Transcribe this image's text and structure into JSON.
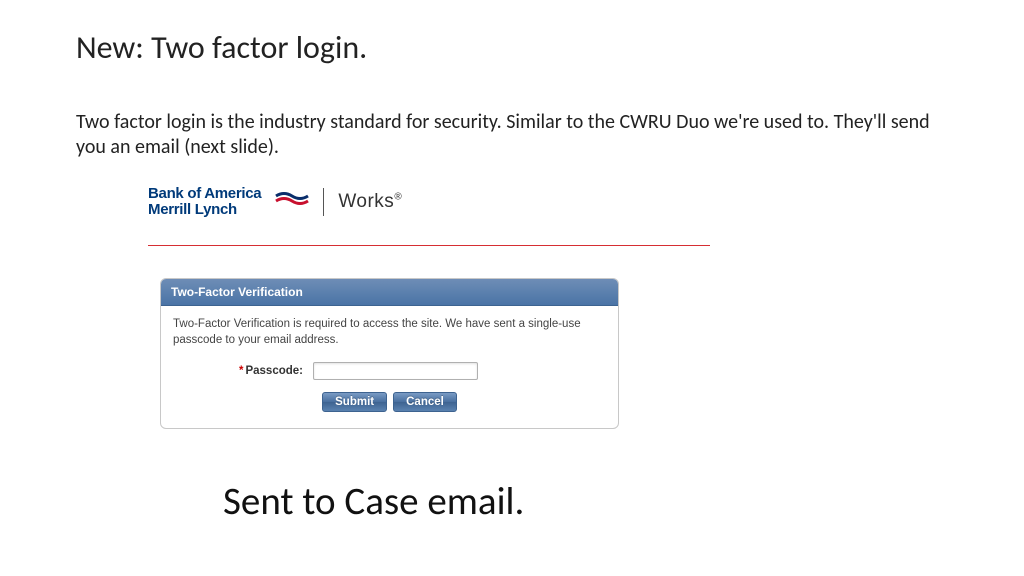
{
  "slide": {
    "title": "New: Two factor login.",
    "subtext": "Two factor login is the industry standard for security. Similar to the CWRU Duo we're used to. They'll send you an email (next slide).",
    "caption": "Sent to Case email."
  },
  "logo": {
    "boa_line1": "Bank of America",
    "boa_line2": "Merrill Lynch",
    "works": "Works",
    "registered": "®"
  },
  "panel": {
    "header": "Two-Factor Verification",
    "message": "Two-Factor Verification is required to access the site. We have sent a single-use passcode to your email address.",
    "required_mark": "*",
    "passcode_label": "Passcode:",
    "passcode_value": "",
    "submit_label": "Submit",
    "cancel_label": "Cancel"
  }
}
